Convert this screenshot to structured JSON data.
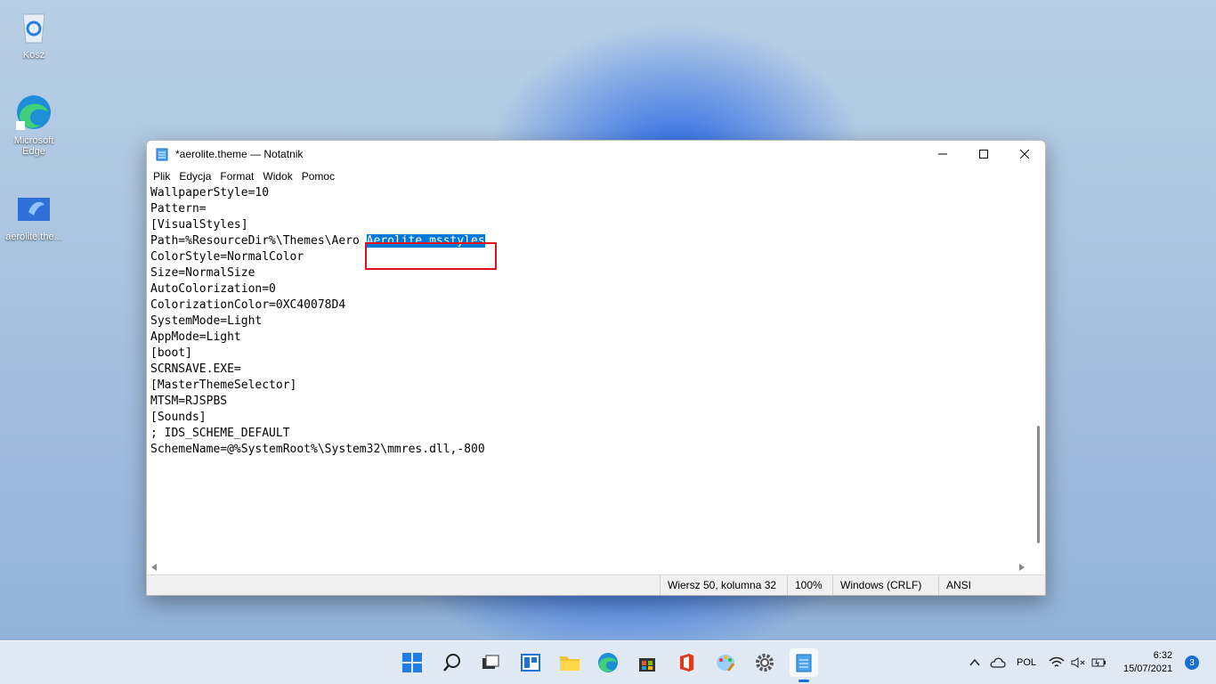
{
  "desktop": {
    "icons": [
      {
        "label": "Kosz",
        "icon": "recycle-bin-icon"
      },
      {
        "label": "Microsoft Edge",
        "icon": "edge-icon"
      },
      {
        "label": "aerolite.the...",
        "icon": "theme-file-icon"
      }
    ]
  },
  "window": {
    "title": "*aerolite.theme — Notatnik",
    "menu": [
      "Plik",
      "Edycja",
      "Format",
      "Widok",
      "Pomoc"
    ],
    "lines": [
      "WallpaperStyle=10",
      "Pattern=",
      "",
      "[VisualStyles]",
      "Path=%ResourceDir%\\Themes\\Aero ",
      "ColorStyle=NormalColor",
      "Size=NormalSize",
      "AutoColorization=0",
      "ColorizationColor=0XC40078D4",
      "SystemMode=Light",
      "AppMode=Light",
      "",
      "[boot]",
      "SCRNSAVE.EXE=",
      "",
      "[MasterThemeSelector]",
      "MTSM=RJSPBS",
      "",
      "[Sounds]",
      "; IDS_SCHEME_DEFAULT",
      "SchemeName=@%SystemRoot%\\System32\\mmres.dll,-800"
    ],
    "selected_text": "Aerolite.msstyles",
    "status": {
      "position": "Wiersz 50, kolumna 32",
      "zoom": "100%",
      "line_ending": "Windows (CRLF)",
      "encoding": "ANSI"
    }
  },
  "taskbar": {
    "apps": [
      "start-icon",
      "search-icon",
      "task-view-icon",
      "widgets-icon",
      "file-explorer-icon",
      "edge-icon",
      "store-icon",
      "office-icon",
      "paint-icon",
      "settings-icon",
      "notepad-icon"
    ],
    "language": "POL",
    "time": "6:32",
    "date": "15/07/2021",
    "notification_count": "3"
  }
}
